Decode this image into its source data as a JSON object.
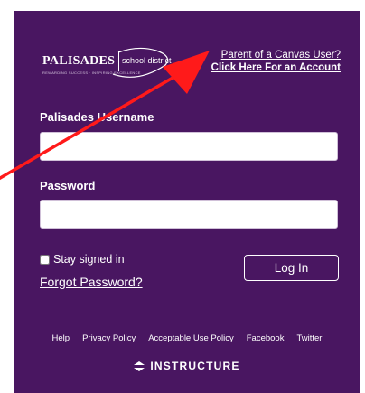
{
  "logo": {
    "name": "PALISADES",
    "district": "school district",
    "tagline": "REWARDING SUCCESS · INSPIRING EXCELLENCE"
  },
  "parent_link": {
    "line1": "Parent of a Canvas User?",
    "line2": "Click Here For an Account"
  },
  "form": {
    "username_label": "Palisades Username",
    "username_value": "",
    "password_label": "Password",
    "password_value": "",
    "stay_signed_in": "Stay signed in",
    "forgot_password": "Forgot Password?",
    "login_button": "Log In"
  },
  "footer": {
    "links": [
      "Help",
      "Privacy Policy",
      "Acceptable Use Policy",
      "Facebook",
      "Twitter"
    ]
  },
  "brand": {
    "name": "INSTRUCTURE"
  },
  "colors": {
    "panel_bg": "#491661",
    "arrow": "#ff1a1a"
  }
}
